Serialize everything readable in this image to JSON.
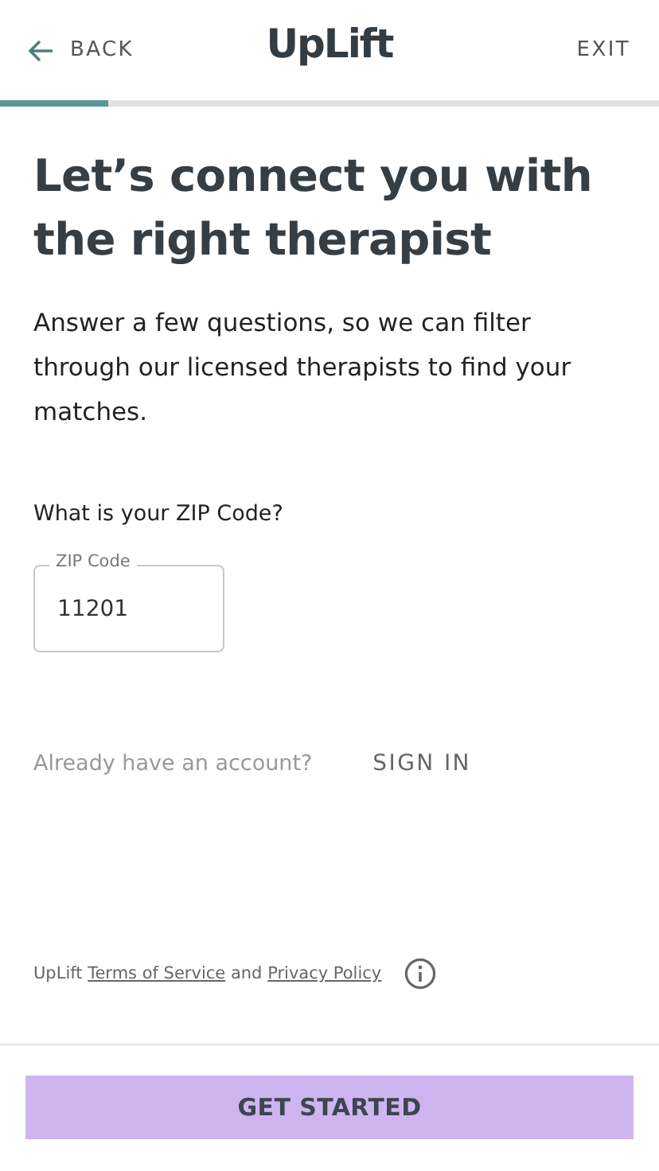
{
  "header": {
    "back": "BACK",
    "logo": "UpLift",
    "exit": "EXIT"
  },
  "progress": {
    "level": 0.165
  },
  "title": "Let’s connect you with the right therapist",
  "intro": "Answer a few questions, so we can filter through our licensed therapists to find your matches.",
  "question": "What is your ZIP Code?",
  "zip_field": {
    "label": "ZIP Code",
    "value": "11201"
  },
  "account": {
    "prompt": "Already have an account?",
    "action": "SIGN IN"
  },
  "legal": {
    "brand": "UpLift",
    "terms": "Terms of Service",
    "joiner": "and",
    "privacy": "Privacy Policy"
  },
  "button": "GET STARTED"
}
